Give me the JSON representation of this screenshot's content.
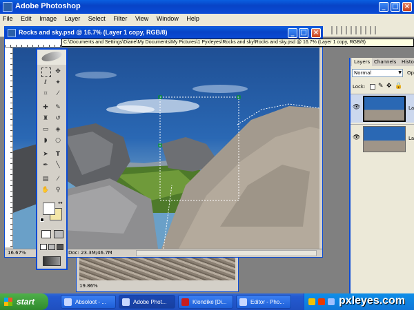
{
  "app": {
    "title": "Adobe Photoshop",
    "menu": [
      "File",
      "Edit",
      "Image",
      "Layer",
      "Select",
      "Filter",
      "View",
      "Window",
      "Help"
    ],
    "controls": {
      "minimize": "_",
      "maximize": "□",
      "close": "×"
    }
  },
  "doc": {
    "title": "Rocks and sky.psd @ 16.7% (Layer 1 copy, RGB/8)",
    "tooltip": "C:\\Documents and Settings\\Diane\\My Documents\\My Pictures\\1 Pyxleyes\\Rocks and sky\\Rocks and sky.psd @ 16.7% (Layer 1 copy, RGB/8)",
    "zoom": "16.67%",
    "doc_size": "Doc: 23.3M/46.7M"
  },
  "doc2": {
    "zoom": "19.86%"
  },
  "layers_panel": {
    "tabs": [
      "Layers",
      "Channels",
      "Histo"
    ],
    "blend_mode": "Normal",
    "opacity_label": "Op",
    "lock_label": "Lock:",
    "layers": [
      {
        "name": "La",
        "selected": true
      },
      {
        "name": "Lay",
        "selected": false
      }
    ]
  },
  "taskbar": {
    "start": "start",
    "items": [
      "Absoloot - ...",
      "Adobe Phot...",
      "Klondike [Di...",
      "Editor - Pho..."
    ],
    "watermark": "pxleyes.com"
  },
  "colors": {
    "xp_blue": "#0a4bd6",
    "task_green": "#3c9a3c",
    "selection": "#00aa00"
  }
}
